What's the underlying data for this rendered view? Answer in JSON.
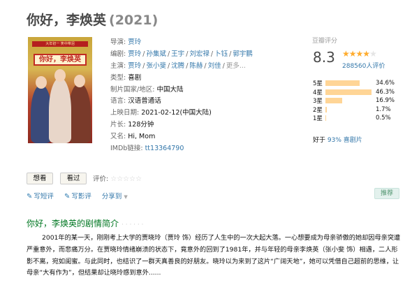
{
  "title": {
    "name": "你好，李焕英",
    "year": "(2021)"
  },
  "poster": {
    "banner": "大年初一 笑中带泪",
    "title": "你好，李焕英"
  },
  "info": {
    "director_label": "导演:",
    "director": "贾玲",
    "writer_label": "编剧:",
    "writers": [
      "贾玲",
      "孙集斌",
      "王宇",
      "刘宏禄",
      "卜钰",
      "郭宇鹏"
    ],
    "cast_label": "主演:",
    "cast": [
      "贾玲",
      "张小斐",
      "沈腾",
      "陈赫",
      "刘佳"
    ],
    "cast_more": "更多...",
    "genre_label": "类型:",
    "genre": "喜剧",
    "region_label": "制片国家/地区:",
    "region": "中国大陆",
    "language_label": "语言:",
    "language": "汉语普通话",
    "release_label": "上映日期:",
    "release": "2021-02-12(中国大陆)",
    "runtime_label": "片长:",
    "runtime": "128分钟",
    "aka_label": "又名:",
    "aka": "Hi, Mom",
    "imdb_label": "IMDb链接:",
    "imdb": "tt13364790"
  },
  "rating": {
    "label": "豆瓣评分",
    "score": "8.3",
    "stars_filled": 4,
    "votes": "288560人评价",
    "distribution": [
      {
        "label": "5星",
        "percent": 34.6,
        "text": "34.6%"
      },
      {
        "label": "4星",
        "percent": 46.3,
        "text": "46.3%"
      },
      {
        "label": "3星",
        "percent": 16.9,
        "text": "16.9%"
      },
      {
        "label": "2星",
        "percent": 1.7,
        "text": "1.7%"
      },
      {
        "label": "1星",
        "percent": 0.5,
        "text": "0.5%"
      }
    ],
    "better_prefix": "好于",
    "better_link": "93% 喜剧片"
  },
  "buttons": {
    "want": "想看",
    "seen": "看过",
    "rate_label": "评价:"
  },
  "actions": {
    "short_review": "写短评",
    "review": "写影评",
    "share": "分享到"
  },
  "recommend": "推荐",
  "summary": {
    "title": "你好，李焕英的剧情简介",
    "dots": "· · · · · ·",
    "text": "2001年的某一天，刚刚考上大学的贾晓玲（贾玲 饰）经历了人生中的一次大起大落。一心想要成为母亲骄傲的她却因母亲突遭严重意外，而悲痛万分。在贾晓玲情绪崩溃的状态下，竟意外的回到了1981年，并与年轻的母亲李焕英（张小斐 饰）相遇，二人形影不离，宛如闺蜜。与此同时，也结识了一群天真善良的好朋友。晓玲以为来到了这片“广阔天地”，她可以凭借自己超前的思维，让母亲“大有作为”，但结果却让晓玲感到意外......"
  }
}
